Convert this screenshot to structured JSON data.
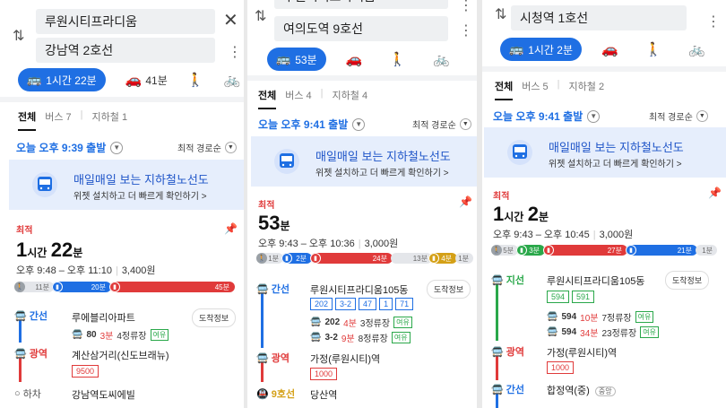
{
  "colors": {
    "blue": "#1f6fe3",
    "red": "#e03a3a",
    "green": "#2aa84a",
    "orange": "#e0a21a",
    "lightblue": "#4a7ef0"
  },
  "panel1": {
    "origin": "루원시티프라디움",
    "destination": "강남역 2호선",
    "modes": {
      "transit": "1시간 22분",
      "car": "41분"
    },
    "tabs": [
      "전체",
      "버스 7",
      "지하철 1"
    ],
    "depart": "오늘 오후 9:39 출발",
    "sort": "최적 경로순",
    "banner": {
      "title": "매일매일 보는 지하철노선도",
      "subtitle": "위젯 설치하고 더 빠르게 확인하기 >"
    },
    "best": "최적",
    "duration": {
      "h": "1",
      "hu": "시간",
      "m": "22",
      "mu": "분"
    },
    "time": "오후 9:48 – 오후 11:10",
    "fare": "3,400원",
    "segments": [
      "11분",
      "20분",
      "45분"
    ],
    "steps": [
      {
        "type": "간선",
        "place": "루에블리아파트",
        "btn": "도착정보",
        "bus": "80",
        "arrive": "3분",
        "stops": "4정류장",
        "status": "여유"
      },
      {
        "type": "광역",
        "place": "계산삼거리(신도브래뉴)",
        "route": "9500"
      },
      {
        "type": "하차",
        "place": "강남역도씨에빌"
      }
    ]
  },
  "panel2": {
    "top_partial": "루원시티프라디움",
    "destination": "여의도역 9호선",
    "modes": {
      "transit": "53분"
    },
    "tabs": [
      "전체",
      "버스 4",
      "지하철 4"
    ],
    "depart": "오늘 오후 9:41 출발",
    "sort": "최적 경로순",
    "banner": {
      "title": "매일매일 보는 지하철노선도",
      "subtitle": "위젯 설치하고 더 빠르게 확인하기 >"
    },
    "best": "최적",
    "duration": {
      "m": "53",
      "mu": "분"
    },
    "time": "오후 9:43 – 오후 10:36",
    "fare": "3,000원",
    "segments": [
      "1분",
      "2분",
      "24분",
      "13분",
      "4분",
      "1분"
    ],
    "steps": [
      {
        "type": "간선",
        "place": "루원시티프라디움105동",
        "btn": "도착정보",
        "routes": [
          "202",
          "3-2",
          "47",
          "1",
          "71"
        ],
        "arrivals": [
          {
            "bus": "202",
            "arrive": "4분",
            "stops": "3정류장",
            "status": "여유"
          },
          {
            "bus": "3-2",
            "arrive": "9분",
            "stops": "8정류장",
            "status": "여유"
          }
        ]
      },
      {
        "type": "광역",
        "place": "가정(루원시티)역",
        "route": "1000"
      },
      {
        "type": "9호선",
        "place": "당산역"
      }
    ]
  },
  "panel3": {
    "destination": "시청역 1호선",
    "modes": {
      "transit": "1시간 2분"
    },
    "tabs": [
      "전체",
      "버스 5",
      "지하철 2"
    ],
    "depart": "오늘 오후 9:41 출발",
    "sort": "최적 경로순",
    "banner": {
      "title": "매일매일 보는 지하철노선도",
      "subtitle": "위젯 설치하고 더 빠르게 확인하기 >"
    },
    "best": "최적",
    "duration": {
      "h": "1",
      "hu": "시간",
      "m": "2",
      "mu": "분"
    },
    "time": "오후 9:43 – 오후 10:45",
    "fare": "3,000원",
    "segments": [
      "5분",
      "3분",
      "27분",
      "21분",
      "1분"
    ],
    "steps": [
      {
        "type": "지선",
        "place": "루원시티프라디움105동",
        "btn": "도착정보",
        "routes": [
          "594",
          "591"
        ],
        "arrivals": [
          {
            "bus": "594",
            "arrive": "10분",
            "stops": "7정류장",
            "status": "여유"
          },
          {
            "bus": "594",
            "arrive": "34분",
            "stops": "23정류장",
            "status": "여유"
          }
        ]
      },
      {
        "type": "광역",
        "place": "가정(루원시티)역",
        "route": "1000"
      },
      {
        "type": "간선",
        "place": "합정역(중)",
        "tag": "중앙"
      }
    ]
  }
}
